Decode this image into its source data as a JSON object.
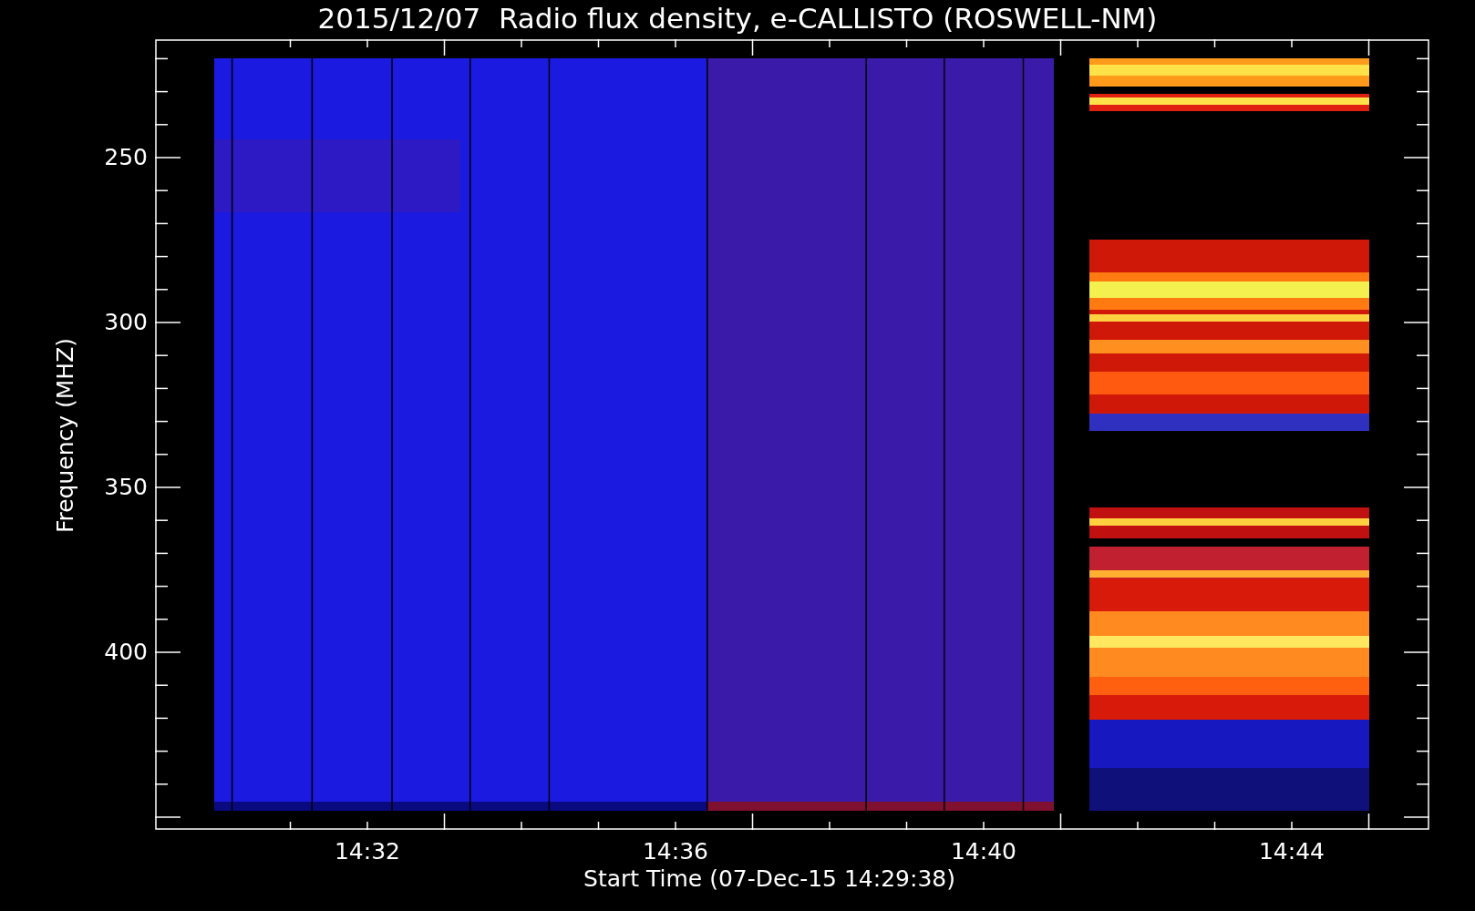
{
  "title": "2015/12/07  Radio flux density, e-CALLISTO (ROSWELL-NM)",
  "plot": {
    "ylabel": "Frequency (MHZ)",
    "xlabel": "Start Time (07-Dec-15 14:29:38)",
    "yticks": [
      "250",
      "300",
      "350",
      "400"
    ],
    "xticks": [
      "14:32",
      "14:36",
      "14:40",
      "14:44"
    ]
  }
}
